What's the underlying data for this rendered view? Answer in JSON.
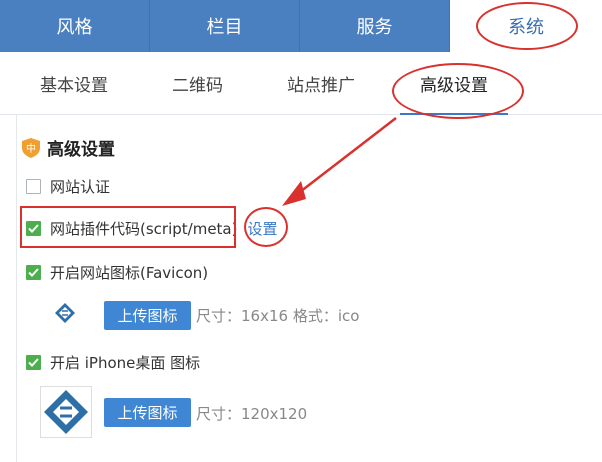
{
  "top_tabs": [
    {
      "label": "风格"
    },
    {
      "label": "栏目"
    },
    {
      "label": "服务"
    },
    {
      "label": "系统"
    }
  ],
  "sub_tabs": [
    {
      "label": "基本设置"
    },
    {
      "label": "二维码"
    },
    {
      "label": "站点推广"
    },
    {
      "label": "高级设置"
    }
  ],
  "section": {
    "title": "高级设置",
    "badge": "中"
  },
  "options": {
    "site_auth": {
      "label": "网站认证",
      "checked": false
    },
    "plugin_code": {
      "label": "网站插件代码(script/meta)",
      "checked": true,
      "link": "设置"
    },
    "favicon": {
      "label": "开启网站图标(Favicon)",
      "checked": true,
      "button": "上传图标",
      "hint": "尺寸：16x16 格式：ico"
    },
    "iphone": {
      "label": "开启 iPhone桌面 图标",
      "checked": true,
      "button": "上传图标",
      "hint": "尺寸：120x120"
    }
  },
  "colors": {
    "tab_bg": "#4a7fc0",
    "accent": "#3a78c8",
    "check": "#4cae4c",
    "annotation": "#d9312e"
  }
}
